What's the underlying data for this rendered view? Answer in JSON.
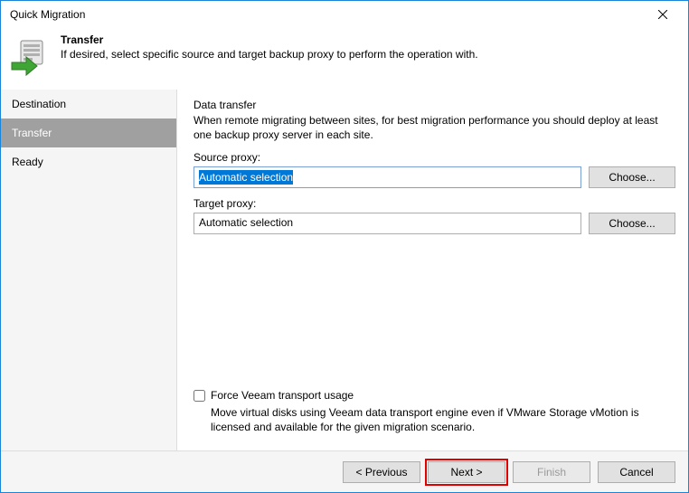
{
  "window": {
    "title": "Quick Migration"
  },
  "header": {
    "title": "Transfer",
    "desc": "If desired, select specific source and target backup proxy to perform the operation with."
  },
  "sidebar": {
    "items": [
      {
        "label": "Destination"
      },
      {
        "label": "Transfer"
      },
      {
        "label": "Ready"
      }
    ]
  },
  "content": {
    "section_label": "Data transfer",
    "section_desc": "When remote migrating between sites, for best migration performance you should deploy at least one backup proxy server in each site.",
    "source_label": "Source proxy:",
    "source_value": "Automatic selection",
    "source_choose": "Choose...",
    "target_label": "Target proxy:",
    "target_value": "Automatic selection",
    "target_choose": "Choose...",
    "force_checkbox_label": "Force Veeam transport usage",
    "force_checkbox_desc": "Move virtual disks using Veeam data transport engine even if VMware Storage vMotion is licensed and available for the given migration scenario."
  },
  "footer": {
    "previous": "< Previous",
    "next": "Next >",
    "finish": "Finish",
    "cancel": "Cancel"
  }
}
